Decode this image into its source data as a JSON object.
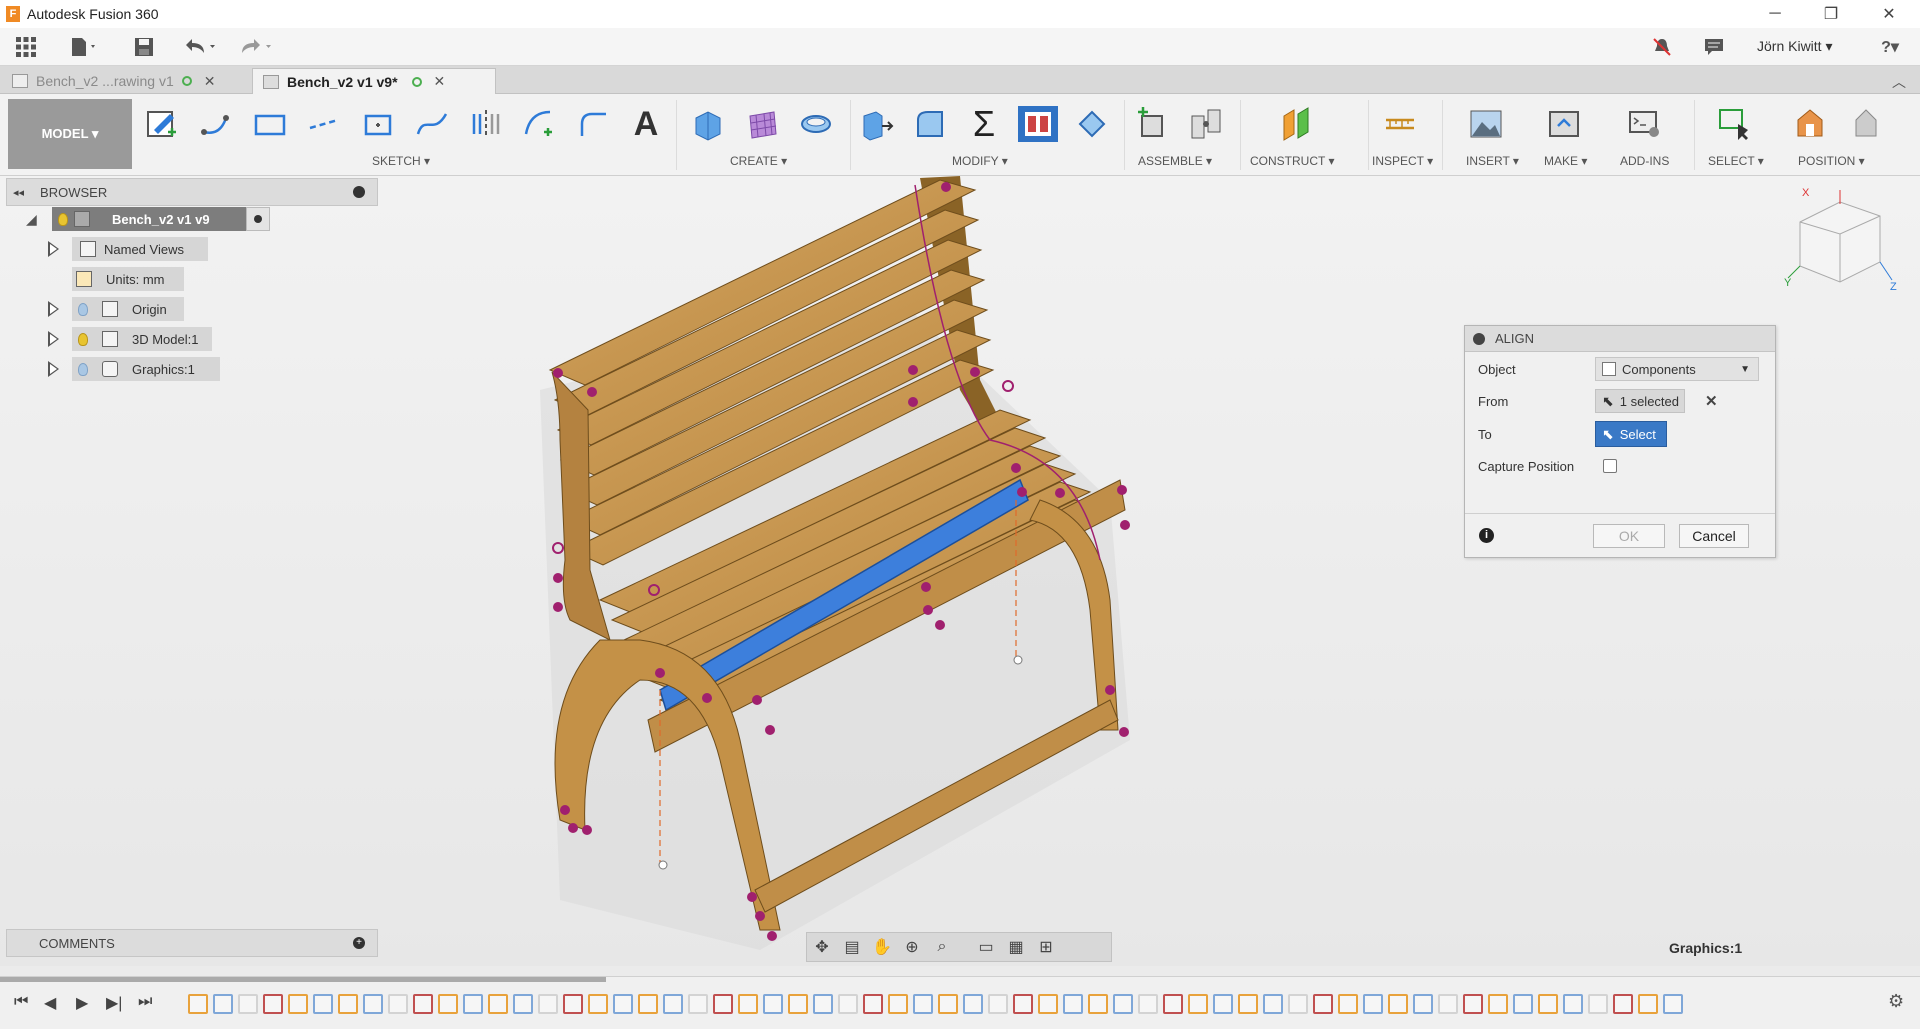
{
  "app": {
    "title": "Autodesk Fusion 360",
    "logo": "F"
  },
  "window_controls": [
    "─",
    "❐",
    "✕"
  ],
  "qat": {
    "user_name": "Jörn Kiwitt ▾",
    "help": "?▾"
  },
  "doc_tabs": [
    {
      "label": "Bench_v2 ...rawing v1",
      "active": false
    },
    {
      "label": "Bench_v2 v1 v9*",
      "active": true
    }
  ],
  "ribbon": {
    "workspace": "MODEL ▾",
    "groups": [
      {
        "label": "SKETCH ▾"
      },
      {
        "label": "CREATE ▾"
      },
      {
        "label": "MODIFY ▾"
      },
      {
        "label": "ASSEMBLE ▾"
      },
      {
        "label": "CONSTRUCT ▾"
      },
      {
        "label": "INSPECT ▾"
      },
      {
        "label": "INSERT ▾"
      },
      {
        "label": "MAKE ▾"
      },
      {
        "label": "ADD-INS"
      },
      {
        "label": "SELECT ▾"
      },
      {
        "label": "POSITION ▾"
      }
    ],
    "text_tool_glyph": "A",
    "sum_tool_glyph": "Σ"
  },
  "browser": {
    "title": "BROWSER",
    "items": [
      {
        "label": "Bench_v2 v1 v9"
      },
      {
        "label": "Named Views"
      },
      {
        "label": "Units: mm"
      },
      {
        "label": "Origin"
      },
      {
        "label": "3D Model:1"
      },
      {
        "label": "Graphics:1"
      }
    ]
  },
  "comments": {
    "title": "COMMENTS"
  },
  "align_dialog": {
    "title": "ALIGN",
    "object_label": "Object",
    "object_value": "Components",
    "from_label": "From",
    "from_value": "1 selected",
    "to_label": "To",
    "to_value": "Select",
    "capture_label": "Capture Position",
    "capture_checked": false,
    "ok_label": "OK",
    "cancel_label": "Cancel"
  },
  "status_selection": "Graphics:1",
  "colors": {
    "wood": "#c9994f",
    "wood_dark": "#8a6326",
    "highlight_blue": "#3d7fdc",
    "constraint_magenta": "#a0206e",
    "select_button": "#3a79c6"
  }
}
